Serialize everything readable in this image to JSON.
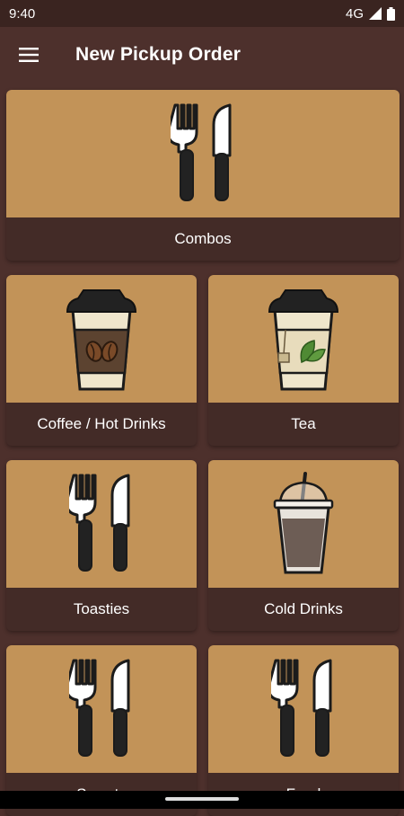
{
  "status": {
    "time": "9:40",
    "network": "4G"
  },
  "app_bar": {
    "title": "New Pickup Order"
  },
  "categories": [
    {
      "label": "Combos",
      "icon": "fork-knife-icon"
    },
    {
      "label": "Coffee / Hot Drinks",
      "icon": "coffee-cup-icon"
    },
    {
      "label": "Tea",
      "icon": "tea-cup-icon"
    },
    {
      "label": "Toasties",
      "icon": "fork-knife-icon"
    },
    {
      "label": "Cold Drinks",
      "icon": "cold-drink-cup-icon"
    },
    {
      "label": "Sweets",
      "icon": "fork-knife-icon"
    },
    {
      "label": "Food",
      "icon": "fork-knife-icon"
    }
  ],
  "colors": {
    "background": "#4d302c",
    "card_image_bg": "#c29358",
    "card_label_bg": "#432b27"
  }
}
